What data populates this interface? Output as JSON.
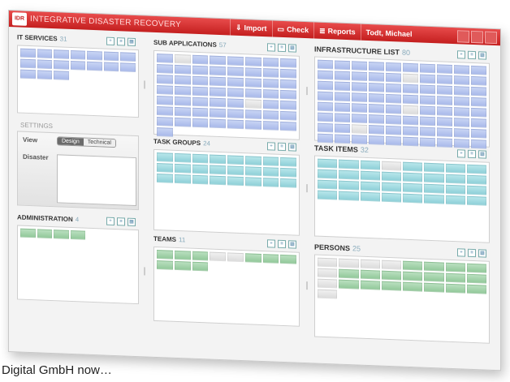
{
  "app": {
    "logo": "IDR",
    "title": "INTEGRATIVE DISASTER RECOVERY",
    "toolbar": [
      {
        "label": "Import",
        "icon": "⇓"
      },
      {
        "label": "Check",
        "icon": "▭"
      },
      {
        "label": "Reports",
        "icon": "≣"
      }
    ],
    "user": "Todt, Michael"
  },
  "panels": {
    "it_services": {
      "title": "IT SERVICES",
      "count": "31"
    },
    "sub_applications": {
      "title": "SUB APPLICATIONS",
      "count": "57"
    },
    "infrastructure": {
      "title": "INFRASTRUCTURE LIST",
      "count": "80"
    },
    "task_groups": {
      "title": "TASK GROUPS",
      "count": "24"
    },
    "task_items": {
      "title": "TASK ITEMS",
      "count": "32"
    },
    "administration": {
      "title": "ADMINISTRATION",
      "count": "4"
    },
    "teams": {
      "title": "TEAMS",
      "count": "11"
    },
    "persons": {
      "title": "PERSONS",
      "count": "25"
    }
  },
  "settings": {
    "heading": "SETTINGS",
    "view_label": "View",
    "view_options": [
      "Design",
      "Technical"
    ],
    "view_selected": "Design",
    "disaster_label": "Disaster"
  },
  "caption": "Digital GmbH now…"
}
